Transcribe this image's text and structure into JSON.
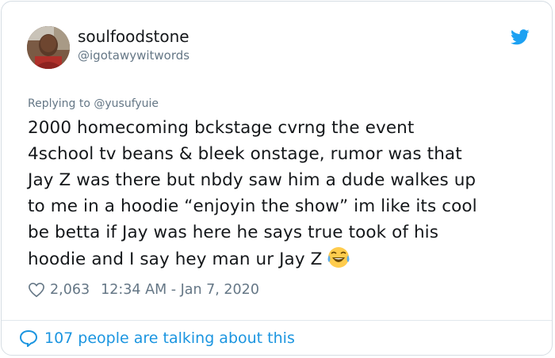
{
  "author": {
    "display_name": "soulfoodstone",
    "handle": "@igotawywitwords"
  },
  "reply_to": "Replying to @yusufyuie",
  "tweet_lines": [
    "2000 homecoming bckstage cvrng the event",
    "4school tv beans & bleek onstage, rumor was that",
    "Jay Z was there but nbdy saw him a dude walkes up",
    "to me in a hoodie “enjoyin the show” im like its cool",
    "be betta if Jay was here he says true took of his",
    "hoodie and I say hey man ur Jay Z"
  ],
  "likes": "2,063",
  "timestamp": "12:34 AM - Jan 7, 2020",
  "footer_text": "107 people are talking about this",
  "icons": {
    "brand": "twitter-bird-icon",
    "like": "heart-icon",
    "talk": "speech-bubble-icon",
    "emoji": "tears-of-joy-emoji"
  },
  "colors": {
    "accent": "#1da1f2",
    "link": "#1b95e0",
    "text": "#14171a",
    "muted": "#657786"
  }
}
